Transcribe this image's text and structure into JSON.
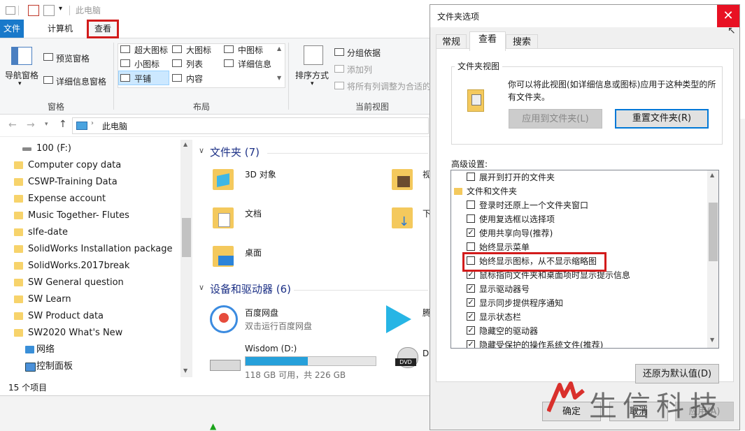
{
  "explorer": {
    "title": "此电脑",
    "ribbon_tabs": [
      "文件",
      "计算机",
      "查看"
    ],
    "panes_group": {
      "nav_pane": "导航窗格",
      "preview": "预览窗格",
      "details": "详细信息窗格",
      "label": "窗格"
    },
    "layout_group": {
      "items": [
        "超大图标",
        "大图标",
        "中图标",
        "小图标",
        "列表",
        "详细信息",
        "平铺",
        "内容"
      ],
      "label": "布局"
    },
    "current_view_group": {
      "sort": "排序方式",
      "group_by": "分组依据",
      "add_columns": "添加列",
      "fit_columns": "将所有列调整为合适的",
      "label": "当前视图"
    },
    "address": "此电脑",
    "nav_items": [
      {
        "label": "100 (F:)",
        "type": "drive"
      },
      {
        "label": "Computer copy data",
        "type": "folder"
      },
      {
        "label": "CSWP-Training Data",
        "type": "folder"
      },
      {
        "label": "Expense account",
        "type": "folder"
      },
      {
        "label": "Music Together- Flutes",
        "type": "folder"
      },
      {
        "label": "slfe-date",
        "type": "folder"
      },
      {
        "label": "SolidWorks Installation package",
        "type": "folder"
      },
      {
        "label": "SolidWorks.2017break",
        "type": "folder"
      },
      {
        "label": "SW General question",
        "type": "folder"
      },
      {
        "label": "SW Learn",
        "type": "folder"
      },
      {
        "label": "SW Product data",
        "type": "folder"
      },
      {
        "label": "SW2020 What's New",
        "type": "folder"
      },
      {
        "label": "网络",
        "type": "network"
      },
      {
        "label": "控制面板",
        "type": "control"
      }
    ],
    "folders_header": "文件夹 (7)",
    "folders": [
      {
        "label": "3D 对象"
      },
      {
        "label": "文档"
      },
      {
        "label": "桌面"
      },
      {
        "label": "视"
      },
      {
        "label": "下"
      }
    ],
    "devices_header": "设备和驱动器 (6)",
    "devices": [
      {
        "label": "百度网盘",
        "sub": "双击运行百度网盘"
      },
      {
        "label": "Wisdom (D:)",
        "sub": "118 GB 可用，共 226 GB",
        "used_fraction": 0.48
      },
      {
        "label": "腾"
      },
      {
        "label": "D'"
      }
    ],
    "status": "15 个项目"
  },
  "dialog": {
    "title": "文件夹选项",
    "tabs": [
      "常规",
      "查看",
      "搜索"
    ],
    "folder_view": {
      "label": "文件夹视图",
      "desc_line1": "你可以将此视图(如详细信息或图标)应用于这种类型的所",
      "desc_line2": "有文件夹。",
      "apply_btn": "应用到文件夹(L)",
      "reset_btn": "重置文件夹(R)"
    },
    "advanced_label": "高级设置:",
    "advanced_items": [
      {
        "label": "展开到打开的文件夹",
        "checked": false,
        "kind": "check"
      },
      {
        "label": "文件和文件夹",
        "checked": false,
        "kind": "folder"
      },
      {
        "label": "登录时还原上一个文件夹窗口",
        "checked": false,
        "kind": "check"
      },
      {
        "label": "使用复选框以选择项",
        "checked": false,
        "kind": "check"
      },
      {
        "label": "使用共享向导(推荐)",
        "checked": true,
        "kind": "check"
      },
      {
        "label": "始终显示菜单",
        "checked": false,
        "kind": "check"
      },
      {
        "label": "始终显示图标，从不显示缩略图",
        "checked": false,
        "kind": "check"
      },
      {
        "label": "鼠标指向文件夹和桌面项时显示提示信息",
        "checked": true,
        "kind": "check"
      },
      {
        "label": "显示驱动器号",
        "checked": true,
        "kind": "check"
      },
      {
        "label": "显示同步提供程序通知",
        "checked": true,
        "kind": "check"
      },
      {
        "label": "显示状态栏",
        "checked": true,
        "kind": "check"
      },
      {
        "label": "隐藏空的驱动器",
        "checked": true,
        "kind": "check"
      },
      {
        "label": "隐藏受保护的操作系统文件(推荐)",
        "checked": true,
        "kind": "check"
      }
    ],
    "restore_btn": "还原为默认值(D)",
    "ok_btn": "确定",
    "cancel_btn": "取消",
    "apply_btn": "应用(A)"
  },
  "watermark": "生信科技",
  "colors": {
    "accent": "#0078d7",
    "highlight": "#d21b1b",
    "close": "#e81123"
  }
}
